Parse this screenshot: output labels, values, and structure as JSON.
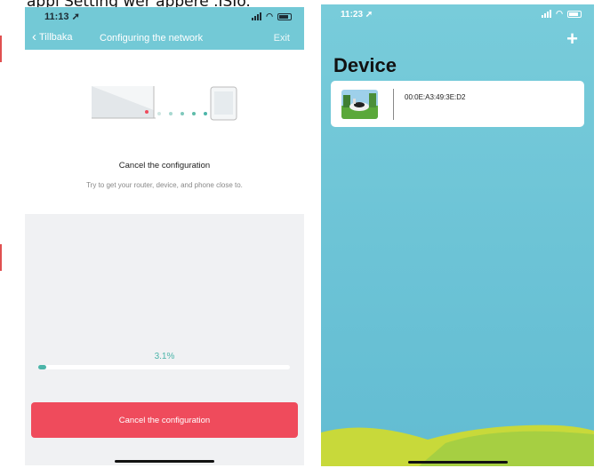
{
  "top_caption": "appl Setting wer appere .ISIo.",
  "left_phone": {
    "status_time": "11:13",
    "nav": {
      "back_label": "Tillbaka",
      "title": "Configuring the network",
      "exit_label": "Exit"
    },
    "config_title": "Cancel the configuration",
    "config_subtitle": "Try to get your router, device, and phone close to.",
    "progress_text": "3.1%",
    "progress_fraction": 0.031,
    "cancel_button_label": "Cancel the configuration"
  },
  "right_phone": {
    "status_time": "11:23",
    "add_icon": "plus-icon",
    "heading": "Device",
    "devices": [
      {
        "mac": "00:0E:A3:49:3E:D2",
        "thumbnail_icon": "robot-mower-image"
      }
    ]
  },
  "colors": {
    "accent_teal": "#73c9d6",
    "progress_green": "#4cb5a9",
    "cancel_red": "#ef4b5c",
    "hill_yellow_green": "#c8d93a"
  }
}
